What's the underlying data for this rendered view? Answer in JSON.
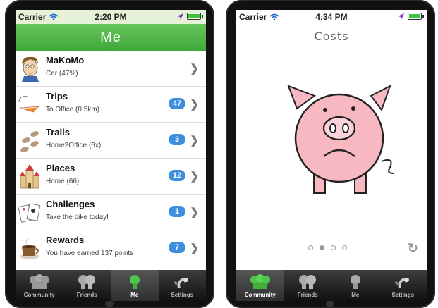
{
  "left_phone": {
    "status": {
      "carrier": "Carrier",
      "time": "2:20 PM"
    },
    "navbar_title": "Me",
    "rows": [
      {
        "title": "MaKoMo",
        "subtitle": "Car (47%)",
        "badge": ""
      },
      {
        "title": "Trips",
        "subtitle": "To Office (0.5km)",
        "badge": "47"
      },
      {
        "title": "Trails",
        "subtitle": "Home2Office (6x)",
        "badge": "3"
      },
      {
        "title": "Places",
        "subtitle": "Home (66)",
        "badge": "12"
      },
      {
        "title": "Challenges",
        "subtitle": "Take the bike today!",
        "badge": "1"
      },
      {
        "title": "Rewards",
        "subtitle": "You have earned 137 points",
        "badge": "7"
      }
    ],
    "tabs": [
      {
        "label": "Community",
        "icon": "community-icon",
        "active": false
      },
      {
        "label": "Friends",
        "icon": "friends-icon",
        "active": false
      },
      {
        "label": "Me",
        "icon": "me-icon",
        "active": true
      },
      {
        "label": "Settings",
        "icon": "settings-icon",
        "active": false
      }
    ]
  },
  "right_phone": {
    "status": {
      "carrier": "Carrier",
      "time": "4:34 PM"
    },
    "title": "Costs",
    "page_dots": {
      "count": 4,
      "active": 2
    },
    "tabs": [
      {
        "label": "Community",
        "icon": "community-icon",
        "active": true
      },
      {
        "label": "Friends",
        "icon": "friends-icon",
        "active": false
      },
      {
        "label": "Me",
        "icon": "me-icon",
        "active": false
      },
      {
        "label": "Settings",
        "icon": "settings-icon",
        "active": false
      }
    ]
  },
  "colors": {
    "nav_green": "#4fb548",
    "badge_blue": "#3e8ee0",
    "pig_pink": "#f7b8c2"
  }
}
